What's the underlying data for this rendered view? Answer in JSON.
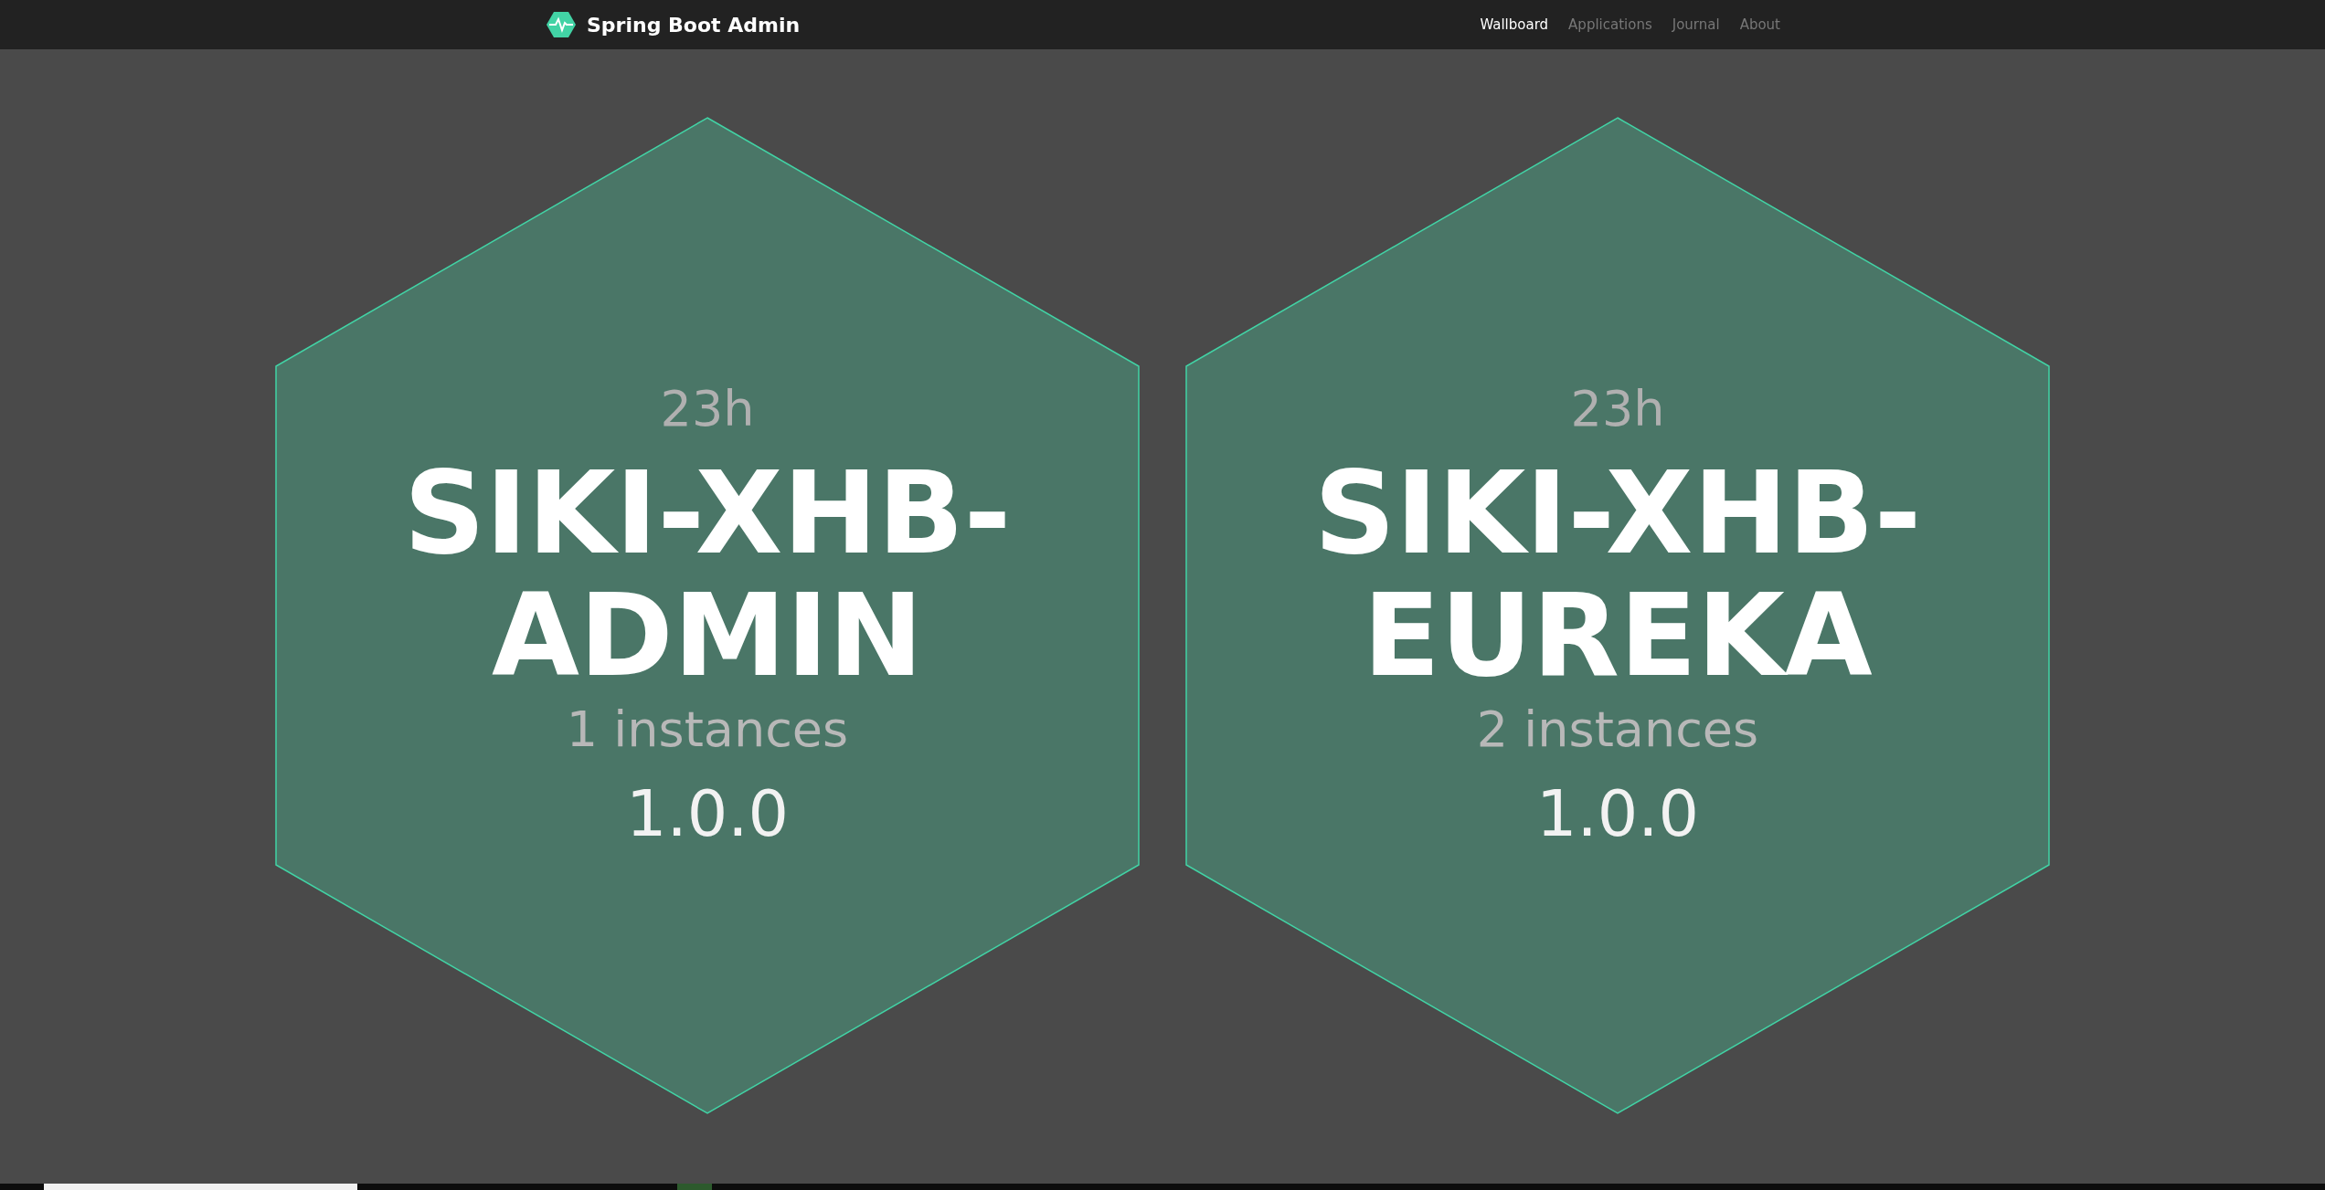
{
  "navbar": {
    "brand": "Spring Boot Admin",
    "items": [
      {
        "label": "Wallboard",
        "selected": true
      },
      {
        "label": "Applications",
        "selected": false
      },
      {
        "label": "Journal",
        "selected": false
      },
      {
        "label": "About",
        "selected": false
      }
    ]
  },
  "applications": [
    {
      "uptime": "23h",
      "name_lines": [
        "SIKI-XHB-",
        "ADMIN"
      ],
      "instances": "1 instances",
      "version": "1.0.0"
    },
    {
      "uptime": "23h",
      "name_lines": [
        "SIKI-XHB-",
        "EUREKA"
      ],
      "instances": "2 instances",
      "version": "1.0.0"
    }
  ]
}
